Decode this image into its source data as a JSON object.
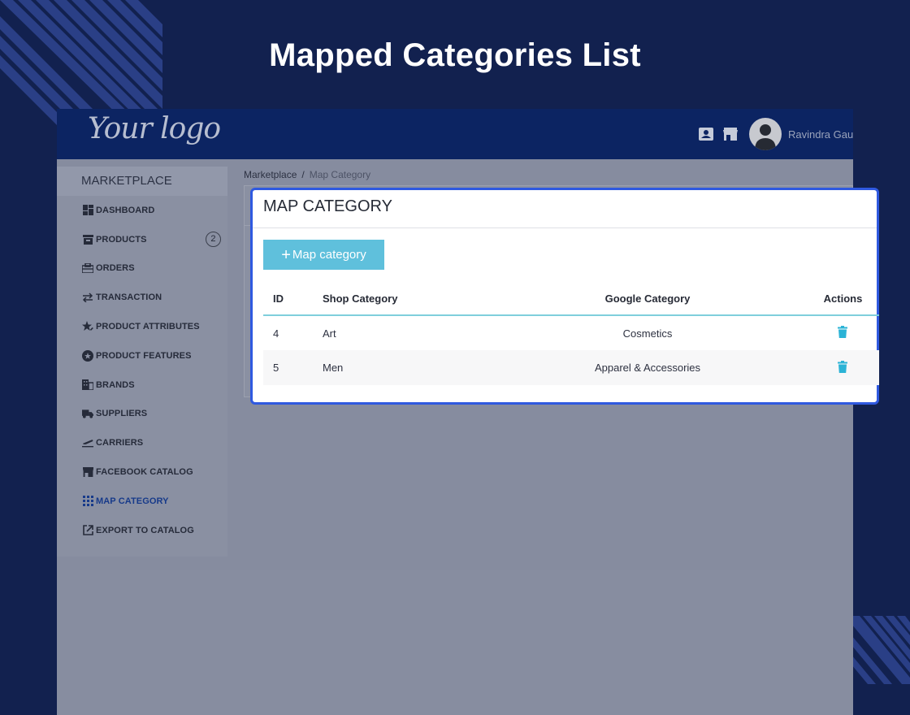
{
  "heading": "Mapped Categories List",
  "colors": {
    "background": "#12214f",
    "topbar": "#0c2462",
    "modal_border": "#2f59e0",
    "button": "#5fc0dc",
    "accent_line": "#7fcfdc",
    "trash_icon": "#2bb3d6"
  },
  "topbar": {
    "logo_text": "Your logo",
    "icons": [
      "contact-card-icon",
      "store-icon"
    ],
    "avatar": "user-avatar-icon",
    "username": "Ravindra Gaut"
  },
  "sidebar": {
    "title": "MARKETPLACE",
    "items": [
      {
        "label": "DASHBOARD",
        "icon": "dashboard-icon"
      },
      {
        "label": "PRODUCTS",
        "icon": "archive-icon",
        "badge": "2"
      },
      {
        "label": "ORDERS",
        "icon": "orders-icon"
      },
      {
        "label": "TRANSACTION",
        "icon": "swap-arrows-icon"
      },
      {
        "label": "PRODUCT ATTRIBUTES",
        "icon": "star-edit-icon"
      },
      {
        "label": "PRODUCT FEATURES",
        "icon": "star-circle-icon"
      },
      {
        "label": "BRANDS",
        "icon": "building-icon"
      },
      {
        "label": "SUPPLIERS",
        "icon": "truck-icon"
      },
      {
        "label": "CARRIERS",
        "icon": "plane-takeoff-icon"
      },
      {
        "label": "FACEBOOK CATALOG",
        "icon": "store-icon"
      },
      {
        "label": "MAP CATEGORY",
        "icon": "grid-dots-icon",
        "active": true
      },
      {
        "label": "EXPORT TO CATALOG",
        "icon": "external-link-icon"
      }
    ]
  },
  "breadcrumb": {
    "root": "Marketplace",
    "separator": "/",
    "current": "Map Category"
  },
  "modal": {
    "title": "MAP CATEGORY",
    "button_label": "Map category",
    "button_icon": "plus-icon",
    "columns": [
      "ID",
      "Shop Category",
      "Google Category",
      "Actions"
    ],
    "rows": [
      {
        "id": "4",
        "shop": "Art",
        "google": "Cosmetics",
        "action_icon": "trash-icon"
      },
      {
        "id": "5",
        "shop": "Men",
        "google": "Apparel & Accessories",
        "action_icon": "trash-icon"
      }
    ]
  }
}
